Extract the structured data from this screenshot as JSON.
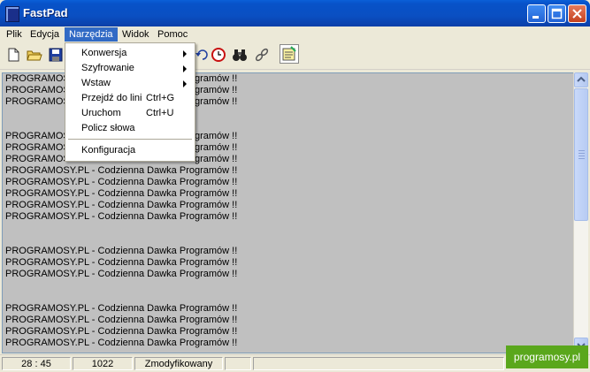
{
  "window": {
    "title": "FastPad",
    "controls": {
      "minimize": "minimize-icon",
      "maximize": "maximize-icon",
      "close": "close-icon"
    }
  },
  "menubar": {
    "items": [
      {
        "label": "Plik"
      },
      {
        "label": "Edycja"
      },
      {
        "label": "Narzędzia",
        "active": true
      },
      {
        "label": "Widok"
      },
      {
        "label": "Pomoc"
      }
    ]
  },
  "toolbar": {
    "icons": [
      "new-file-icon",
      "open-folder-icon",
      "save-icon",
      "undo-icon",
      "clock-icon",
      "binoculars-icon",
      "link-icon",
      "notes-icon"
    ]
  },
  "dropdown": {
    "items": [
      {
        "label": "Konwersja",
        "shortcut": "",
        "submenu": true
      },
      {
        "label": "Szyfrowanie",
        "shortcut": "",
        "submenu": true
      },
      {
        "label": "Wstaw",
        "shortcut": "",
        "submenu": true
      },
      {
        "label": "Przejdź do lini",
        "shortcut": "Ctrl+G",
        "submenu": false
      },
      {
        "label": "Uruchom",
        "shortcut": "Ctrl+U",
        "submenu": false
      },
      {
        "label": "Policz słowa",
        "shortcut": "",
        "submenu": false
      },
      {
        "label": "Konfiguracja",
        "shortcut": "",
        "submenu": false
      }
    ]
  },
  "editor": {
    "lines": [
      "PROGRAMOSY.PL - Codzienna Dawka Programów !!",
      "PROGRAMOSY.PL - Codzienna Dawka Programów !!",
      "PROGRAMOSY.PL - Codzienna Dawka Programów !!",
      "",
      "",
      "PROGRAMOSY.PL - Codzienna Dawka Programów !!",
      "PROGRAMOSY.PL - Codzienna Dawka Programów !!",
      "PROGRAMOSY.PL - Codzienna Dawka Programów !!",
      "PROGRAMOSY.PL - Codzienna Dawka Programów !!",
      "PROGRAMOSY.PL - Codzienna Dawka Programów !!",
      "PROGRAMOSY.PL - Codzienna Dawka Programów !!",
      "PROGRAMOSY.PL - Codzienna Dawka Programów !!",
      "PROGRAMOSY.PL - Codzienna Dawka Programów !!",
      "",
      "",
      "PROGRAMOSY.PL - Codzienna Dawka Programów !!",
      "PROGRAMOSY.PL - Codzienna Dawka Programów !!",
      "PROGRAMOSY.PL - Codzienna Dawka Programów !!",
      "",
      "",
      "PROGRAMOSY.PL - Codzienna Dawka Programów !!",
      "PROGRAMOSY.PL - Codzienna Dawka Programów !!",
      "PROGRAMOSY.PL - Codzienna Dawka Programów !!",
      "PROGRAMOSY.PL - Codzienna Dawka Programów !!"
    ]
  },
  "statusbar": {
    "position": "28 : 45",
    "count": "1022",
    "state": "Zmodyfikowany"
  },
  "watermark": "programosy.pl"
}
